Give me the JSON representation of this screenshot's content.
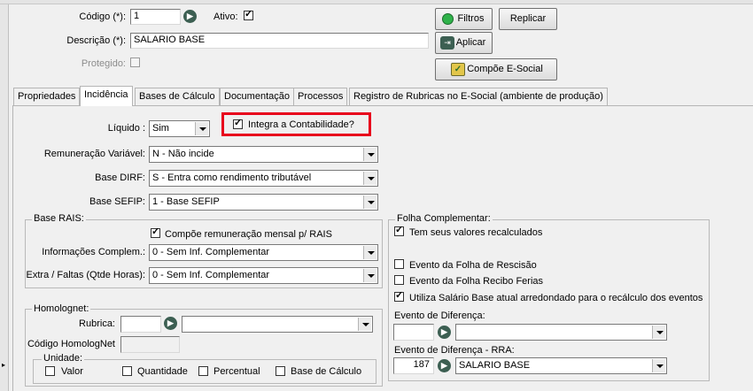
{
  "header": {
    "codigo_label": "Código (*):",
    "codigo_value": "1",
    "ativo_label": "Ativo:",
    "descricao_label": "Descrição (*):",
    "descricao_value": "SALARIO BASE",
    "protegido_label": "Protegido:"
  },
  "buttons": {
    "filtros": "Filtros",
    "replicar": "Replicar",
    "aplicar": "Aplicar",
    "compoe": "Compõe E-Social"
  },
  "tabs": [
    {
      "label": "Propriedades"
    },
    {
      "label": "Incidência"
    },
    {
      "label": "Bases de Cálculo"
    },
    {
      "label": "Documentação"
    },
    {
      "label": "Processos"
    },
    {
      "label": "Registro de Rubricas no E-Social (ambiente de produção)"
    }
  ],
  "incidencia": {
    "liquido_label": "Líquido :",
    "liquido_value": "Sim",
    "integra_label": "Integra a Contabilidade?",
    "remuneracao_label": "Remuneração Variável:",
    "remuneracao_value": "N - Não incide",
    "dirf_label": "Base DIRF:",
    "dirf_value": "S - Entra como rendimento tributável",
    "sefip_label": "Base SEFIP:",
    "sefip_value": "1 - Base SEFIP"
  },
  "rais": {
    "title": "Base RAIS:",
    "compoe_label": "Compõe remuneração mensal p/ RAIS",
    "info_label": "Informações Complem.:",
    "info_value": "0 - Sem Inf. Complementar",
    "extra_label": "Extra / Faltas (Qtde Horas):",
    "extra_value": "0 - Sem Inf. Complementar"
  },
  "homolognet": {
    "title": "Homolognet:",
    "rubrica_label": "Rubrica:",
    "codigo_label": "Código HomologNet",
    "unidade_title": "Unidade:",
    "valor": "Valor",
    "quantidade": "Quantidade",
    "percentual": "Percentual",
    "base_calculo": "Base de Cálculo"
  },
  "folha": {
    "title": "Folha Complementar:",
    "tem_seus": "Tem seus valores recalculados",
    "rescisao": "Evento da Folha de Rescisão",
    "ferias": "Evento da Folha Recibo Ferias",
    "utiliza": "Utiliza Salário Base atual arredondado para o recálculo dos eventos",
    "diferenca_label": "Evento de Diferença:",
    "diferenca_rra_label": "Evento de Diferença - RRA:",
    "rra_code": "187",
    "rra_value": "SALARIO BASE"
  },
  "colors": {
    "highlight": "#e8001c",
    "icon": "#3c5f52",
    "filtros_icon": "#2fb24a"
  }
}
